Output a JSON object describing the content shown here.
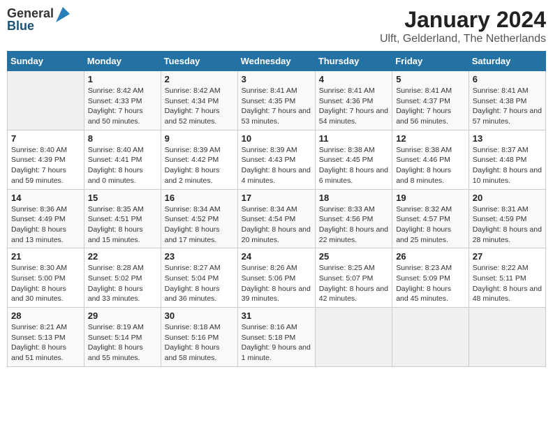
{
  "header": {
    "logo_general": "General",
    "logo_blue": "Blue",
    "title": "January 2024",
    "subtitle": "Ulft, Gelderland, The Netherlands"
  },
  "calendar": {
    "days_of_week": [
      "Sunday",
      "Monday",
      "Tuesday",
      "Wednesday",
      "Thursday",
      "Friday",
      "Saturday"
    ],
    "weeks": [
      [
        {
          "day": "",
          "sunrise": "",
          "sunset": "",
          "daylight": ""
        },
        {
          "day": "1",
          "sunrise": "Sunrise: 8:42 AM",
          "sunset": "Sunset: 4:33 PM",
          "daylight": "Daylight: 7 hours and 50 minutes."
        },
        {
          "day": "2",
          "sunrise": "Sunrise: 8:42 AM",
          "sunset": "Sunset: 4:34 PM",
          "daylight": "Daylight: 7 hours and 52 minutes."
        },
        {
          "day": "3",
          "sunrise": "Sunrise: 8:41 AM",
          "sunset": "Sunset: 4:35 PM",
          "daylight": "Daylight: 7 hours and 53 minutes."
        },
        {
          "day": "4",
          "sunrise": "Sunrise: 8:41 AM",
          "sunset": "Sunset: 4:36 PM",
          "daylight": "Daylight: 7 hours and 54 minutes."
        },
        {
          "day": "5",
          "sunrise": "Sunrise: 8:41 AM",
          "sunset": "Sunset: 4:37 PM",
          "daylight": "Daylight: 7 hours and 56 minutes."
        },
        {
          "day": "6",
          "sunrise": "Sunrise: 8:41 AM",
          "sunset": "Sunset: 4:38 PM",
          "daylight": "Daylight: 7 hours and 57 minutes."
        }
      ],
      [
        {
          "day": "7",
          "sunrise": "Sunrise: 8:40 AM",
          "sunset": "Sunset: 4:39 PM",
          "daylight": "Daylight: 7 hours and 59 minutes."
        },
        {
          "day": "8",
          "sunrise": "Sunrise: 8:40 AM",
          "sunset": "Sunset: 4:41 PM",
          "daylight": "Daylight: 8 hours and 0 minutes."
        },
        {
          "day": "9",
          "sunrise": "Sunrise: 8:39 AM",
          "sunset": "Sunset: 4:42 PM",
          "daylight": "Daylight: 8 hours and 2 minutes."
        },
        {
          "day": "10",
          "sunrise": "Sunrise: 8:39 AM",
          "sunset": "Sunset: 4:43 PM",
          "daylight": "Daylight: 8 hours and 4 minutes."
        },
        {
          "day": "11",
          "sunrise": "Sunrise: 8:38 AM",
          "sunset": "Sunset: 4:45 PM",
          "daylight": "Daylight: 8 hours and 6 minutes."
        },
        {
          "day": "12",
          "sunrise": "Sunrise: 8:38 AM",
          "sunset": "Sunset: 4:46 PM",
          "daylight": "Daylight: 8 hours and 8 minutes."
        },
        {
          "day": "13",
          "sunrise": "Sunrise: 8:37 AM",
          "sunset": "Sunset: 4:48 PM",
          "daylight": "Daylight: 8 hours and 10 minutes."
        }
      ],
      [
        {
          "day": "14",
          "sunrise": "Sunrise: 8:36 AM",
          "sunset": "Sunset: 4:49 PM",
          "daylight": "Daylight: 8 hours and 13 minutes."
        },
        {
          "day": "15",
          "sunrise": "Sunrise: 8:35 AM",
          "sunset": "Sunset: 4:51 PM",
          "daylight": "Daylight: 8 hours and 15 minutes."
        },
        {
          "day": "16",
          "sunrise": "Sunrise: 8:34 AM",
          "sunset": "Sunset: 4:52 PM",
          "daylight": "Daylight: 8 hours and 17 minutes."
        },
        {
          "day": "17",
          "sunrise": "Sunrise: 8:34 AM",
          "sunset": "Sunset: 4:54 PM",
          "daylight": "Daylight: 8 hours and 20 minutes."
        },
        {
          "day": "18",
          "sunrise": "Sunrise: 8:33 AM",
          "sunset": "Sunset: 4:56 PM",
          "daylight": "Daylight: 8 hours and 22 minutes."
        },
        {
          "day": "19",
          "sunrise": "Sunrise: 8:32 AM",
          "sunset": "Sunset: 4:57 PM",
          "daylight": "Daylight: 8 hours and 25 minutes."
        },
        {
          "day": "20",
          "sunrise": "Sunrise: 8:31 AM",
          "sunset": "Sunset: 4:59 PM",
          "daylight": "Daylight: 8 hours and 28 minutes."
        }
      ],
      [
        {
          "day": "21",
          "sunrise": "Sunrise: 8:30 AM",
          "sunset": "Sunset: 5:00 PM",
          "daylight": "Daylight: 8 hours and 30 minutes."
        },
        {
          "day": "22",
          "sunrise": "Sunrise: 8:28 AM",
          "sunset": "Sunset: 5:02 PM",
          "daylight": "Daylight: 8 hours and 33 minutes."
        },
        {
          "day": "23",
          "sunrise": "Sunrise: 8:27 AM",
          "sunset": "Sunset: 5:04 PM",
          "daylight": "Daylight: 8 hours and 36 minutes."
        },
        {
          "day": "24",
          "sunrise": "Sunrise: 8:26 AM",
          "sunset": "Sunset: 5:06 PM",
          "daylight": "Daylight: 8 hours and 39 minutes."
        },
        {
          "day": "25",
          "sunrise": "Sunrise: 8:25 AM",
          "sunset": "Sunset: 5:07 PM",
          "daylight": "Daylight: 8 hours and 42 minutes."
        },
        {
          "day": "26",
          "sunrise": "Sunrise: 8:23 AM",
          "sunset": "Sunset: 5:09 PM",
          "daylight": "Daylight: 8 hours and 45 minutes."
        },
        {
          "day": "27",
          "sunrise": "Sunrise: 8:22 AM",
          "sunset": "Sunset: 5:11 PM",
          "daylight": "Daylight: 8 hours and 48 minutes."
        }
      ],
      [
        {
          "day": "28",
          "sunrise": "Sunrise: 8:21 AM",
          "sunset": "Sunset: 5:13 PM",
          "daylight": "Daylight: 8 hours and 51 minutes."
        },
        {
          "day": "29",
          "sunrise": "Sunrise: 8:19 AM",
          "sunset": "Sunset: 5:14 PM",
          "daylight": "Daylight: 8 hours and 55 minutes."
        },
        {
          "day": "30",
          "sunrise": "Sunrise: 8:18 AM",
          "sunset": "Sunset: 5:16 PM",
          "daylight": "Daylight: 8 hours and 58 minutes."
        },
        {
          "day": "31",
          "sunrise": "Sunrise: 8:16 AM",
          "sunset": "Sunset: 5:18 PM",
          "daylight": "Daylight: 9 hours and 1 minute."
        },
        {
          "day": "",
          "sunrise": "",
          "sunset": "",
          "daylight": ""
        },
        {
          "day": "",
          "sunrise": "",
          "sunset": "",
          "daylight": ""
        },
        {
          "day": "",
          "sunrise": "",
          "sunset": "",
          "daylight": ""
        }
      ]
    ]
  }
}
